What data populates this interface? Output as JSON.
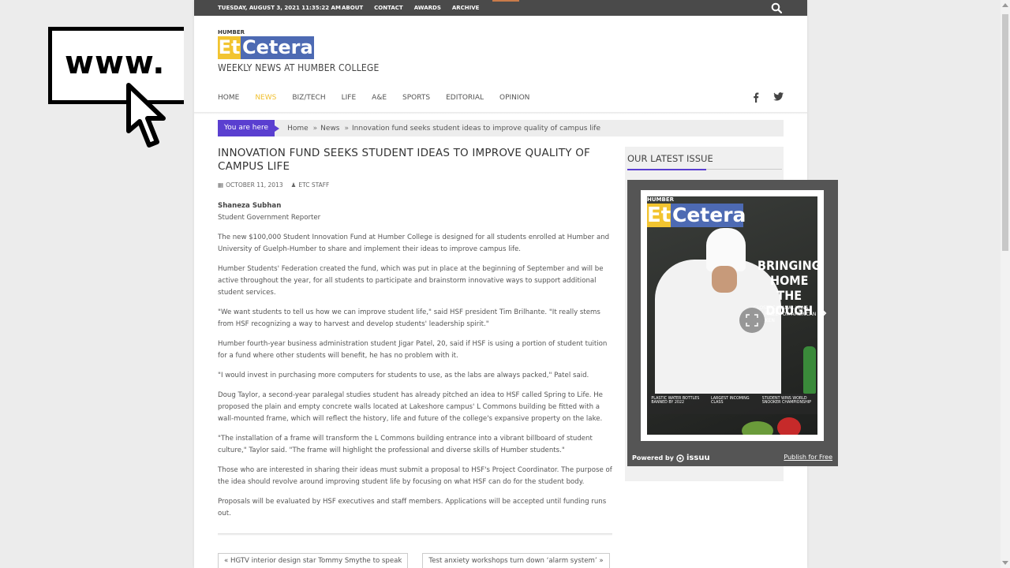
{
  "overlay": {
    "www_text": "www."
  },
  "topbar": {
    "date": "TUESDAY, AUGUST 3, 2021   11:35:22 AM",
    "links": [
      "ABOUT",
      "CONTACT",
      "AWARDS",
      "ARCHIVE"
    ]
  },
  "logo": {
    "humber": "HUMBER",
    "et": "Et",
    "cetera": "Cetera"
  },
  "tagline": "WEEKLY NEWS AT HUMBER COLLEGE",
  "mainnav": {
    "items": [
      "HOME",
      "NEWS",
      "BIZ/TECH",
      "LIFE",
      "A&E",
      "SPORTS",
      "EDITORIAL",
      "OPINION"
    ],
    "active_index": 1
  },
  "breadcrumb": {
    "label": "You are here",
    "items": [
      "Home",
      "News",
      "Innovation fund seeks student ideas to improve quality of campus life"
    ]
  },
  "article": {
    "title": "INNOVATION FUND SEEKS STUDENT IDEAS TO IMPROVE QUALITY OF CAMPUS LIFE",
    "date": "OCTOBER 11, 2013",
    "author_tag": "ETC STAFF",
    "author_name": "Shaneza Subhan",
    "author_role": "Student Government Reporter",
    "paragraphs": [
      "The new $100,000 Student Innovation Fund at Humber College is designed for all students enrolled at Humber and University of Guelph-Humber to share and implement their ideas to improve campus life.",
      "Humber Students' Federation created the fund, which was put in place at the beginning of September and will be active throughout the year, for all students to participate and brainstorm innovative ways to support additional student services.",
      "\"We want students to tell us how we can improve student life,\" said HSF president Tim Brilhante. \"It really stems from HSF recognizing a way to harvest and develop students' leadership spirit.\"",
      "Humber fourth-year business administration student Jigar Patel, 20, said if HSF is using a portion of student tuition for a fund where other students will benefit, he has no problem with it.",
      "\"I would invest in purchasing more computers for students to use, as the labs are always packed,\" Patel said.",
      "Doug Taylor, a second-year paralegal studies student has already pitched an idea to HSF called Spring to Life. He proposed the plain and empty concrete walls located at Lakeshore campus' L Commons building be fitted with a wall-mounted frame, which will reflect the history, life and future of the college's expansive property on the lake.",
      "\"The installation of a frame will transform the L Commons building entrance into a vibrant billboard of student culture,\" Taylor said. \"The frame will highlight the professional and diverse skills of Humber students.\"",
      "Those who are interested in sharing their ideas must submit a proposal to HSF's Project Coordinator. The purpose of the idea should revolve around improving student life by focusing on what HSF can do for the student body.",
      "Proposals will be evaluated by HSF executives and staff members. Applications will be accepted until funding runs out."
    ]
  },
  "postnav": {
    "prev": "« HGTV interior design star Tommy Smythe to speak",
    "next": "Test anxiety workshops turn down ‘alarm system’ »"
  },
  "sidebar": {
    "title": "OUR LATEST ISSUE"
  },
  "issuu": {
    "cover_humber": "HUMBER",
    "cover_et": "Et",
    "cover_cetera": "Cetera",
    "headline": "BRINGING\nHOME\nTHE DOUGH",
    "subhead": "CLOSIA CAVANAL WINS TOP PRIZE FOR AMERICAN CHICKEN",
    "strip": [
      "PLASTIC WATER BOTTLES BANNED BY 2022",
      "LARGEST INCOMING CLASS",
      "STUDENT WINS WORLD SNOOKER CHAMPIONSHIP"
    ],
    "powered_by": "Powered by",
    "brand": "issuu",
    "publish": "Publish for Free"
  },
  "colors": {
    "accent_purple": "#5a3fd0",
    "logo_yellow": "#f2c430",
    "logo_blue": "#4d6ab3",
    "topbar": "#4a4a4a"
  }
}
